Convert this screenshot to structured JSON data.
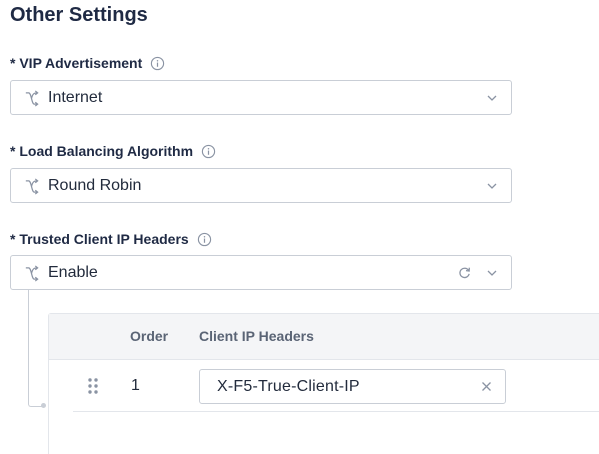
{
  "section": {
    "title": "Other Settings"
  },
  "vip_advertisement": {
    "label": "* VIP Advertisement",
    "value": "Internet",
    "info_icon": "info-icon",
    "value_icon": "route-icon",
    "dropdown_icon": "chevron-down-icon"
  },
  "load_balancing": {
    "label": "* Load Balancing Algorithm",
    "value": "Round Robin",
    "info_icon": "info-icon",
    "value_icon": "route-icon",
    "dropdown_icon": "chevron-down-icon"
  },
  "trusted_client_ip": {
    "label": "* Trusted Client IP Headers",
    "value": "Enable",
    "info_icon": "info-icon",
    "value_icon": "route-icon",
    "reset_icon": "refresh-icon",
    "dropdown_icon": "chevron-down-icon"
  },
  "headers_table": {
    "columns": [
      "Order",
      "Client IP Headers"
    ],
    "rows": [
      {
        "order": "1",
        "header": "X-F5-True-Client-IP"
      }
    ]
  },
  "colors": {
    "text_primary": "#1f2a44",
    "border": "#c9ced6",
    "table_header_bg": "#f4f5f7",
    "icon_gray": "#8a93a3"
  }
}
